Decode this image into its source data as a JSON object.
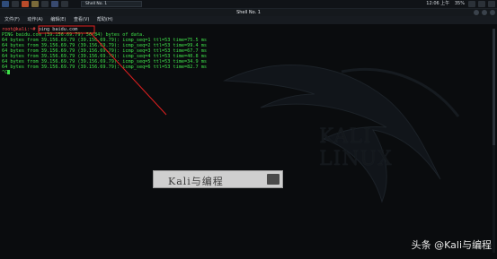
{
  "panel": {
    "task_label": "Shell No. 1",
    "time": "12:06 上午",
    "battery": "35%"
  },
  "window": {
    "title": "Shell No. 1",
    "menu": [
      "文件(F)",
      "动作(A)",
      "编辑(E)",
      "查看(V)",
      "帮助(H)"
    ]
  },
  "terminal": {
    "prompt": "root@kali:~#",
    "command": " ping baidu.com",
    "lines": [
      "PING baidu.com (39.156.69.79) 56(84) bytes of data.",
      "64 bytes from 39.156.69.79 (39.156.69.79): icmp_seq=1 ttl=53 time=75.5 ms",
      "64 bytes from 39.156.69.79 (39.156.69.79): icmp_seq=2 ttl=53 time=99.4 ms",
      "64 bytes from 39.156.69.79 (39.156.69.79): icmp_seq=3 ttl=53 time=67.7 ms",
      "64 bytes from 39.156.69.79 (39.156.69.79): icmp_seq=4 ttl=53 time=40.8 ms",
      "64 bytes from 39.156.69.79 (39.156.69.79): icmp_seq=5 ttl=53 time=34.9 ms",
      "64 bytes from 39.156.69.79 (39.156.69.79): icmp_seq=6 ttl=53 time=82.7 ms"
    ],
    "interrupt": "^C"
  },
  "wallpaper": {
    "logo_text": "KALI LINUX"
  },
  "search_banner": {
    "text": "Kali与编程"
  },
  "watermark": {
    "text": "头条 @Kali与编程"
  },
  "colors": {
    "terminal_green": "#3fe24a",
    "prompt_red": "#ff4d4d",
    "annotation_red": "#e12020"
  }
}
